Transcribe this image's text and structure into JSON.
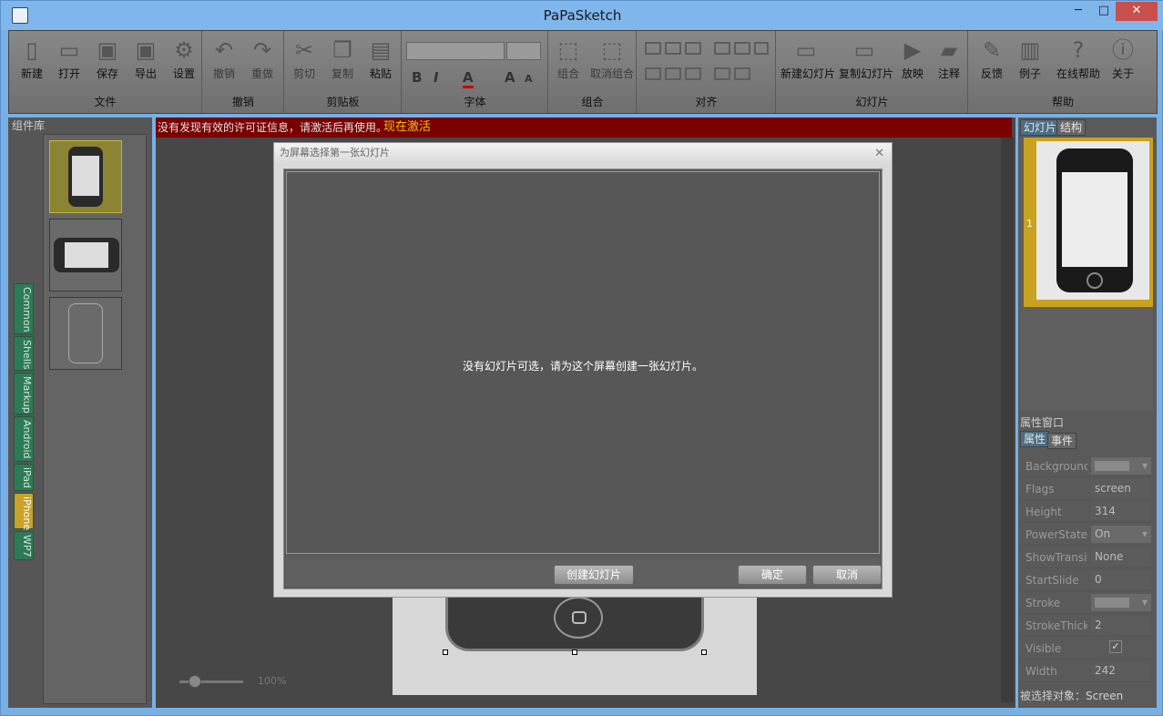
{
  "window": {
    "title": "PaPaSketch",
    "minimize": "─",
    "maximize": "□",
    "close": "✕"
  },
  "ribbon": {
    "file": {
      "label": "文件",
      "buttons": [
        "新建",
        "打开",
        "保存",
        "导出",
        "设置"
      ]
    },
    "undo": {
      "label": "撤销",
      "buttons": [
        "撤销",
        "重做"
      ]
    },
    "clipboard": {
      "label": "剪贴板",
      "buttons": [
        "剪切",
        "复制",
        "粘贴"
      ]
    },
    "font": {
      "label": "字体",
      "bold": "B",
      "italic": "I",
      "color": "A",
      "grow": "A",
      "shrink": "A"
    },
    "group": {
      "label": "组合",
      "buttons": [
        "组合",
        "取消组合"
      ]
    },
    "align": {
      "label": "对齐"
    },
    "slides": {
      "label": "幻灯片",
      "buttons": [
        "新建幻灯片",
        "复制幻灯片",
        "放映",
        "注释"
      ]
    },
    "help": {
      "label": "帮助",
      "buttons": [
        "反馈",
        "例子",
        "在线帮助",
        "关于"
      ]
    }
  },
  "left_panel": {
    "header": "组件库",
    "tabs": [
      "Common",
      "Shells",
      "Markup",
      "Android",
      "iPad",
      "iPhone",
      "WP7"
    ],
    "selected_tab": "iPhone"
  },
  "warning": {
    "text": "没有发现有效的许可证信息，请激活后再使用。",
    "action": "现在激活"
  },
  "zoom": {
    "value": "100%",
    "level": 0.15
  },
  "right_panel": {
    "tabs": [
      "幻灯片",
      "结构"
    ],
    "slide_number": "1",
    "props_header": "属性窗口",
    "props_tabs": [
      "属性",
      "事件"
    ],
    "properties": [
      {
        "name": "Background",
        "value": ""
      },
      {
        "name": "Flags",
        "value": "screen"
      },
      {
        "name": "Height",
        "value": "314"
      },
      {
        "name": "PowerState",
        "value": "On"
      },
      {
        "name": "ShowTransition",
        "value": "None"
      },
      {
        "name": "StartSlide",
        "value": "0"
      },
      {
        "name": "Stroke",
        "value": ""
      },
      {
        "name": "StrokeThickness",
        "value": "2"
      },
      {
        "name": "Visible",
        "value": "✓"
      },
      {
        "name": "Width",
        "value": "242"
      }
    ],
    "status": "被选择对象：Screen"
  },
  "dialog": {
    "title": "为屏幕选择第一张幻灯片",
    "message": "没有幻灯片可选，请为这个屏幕创建一张幻灯片。",
    "create_button": "创建幻灯片",
    "ok_button": "确定",
    "cancel_button": "取消",
    "close": "✕"
  },
  "colors": {
    "accent": "#c9a227",
    "warning_bg": "#7a0000",
    "warning_action": "#f0c000",
    "titlebar": "#7fb6ec"
  }
}
